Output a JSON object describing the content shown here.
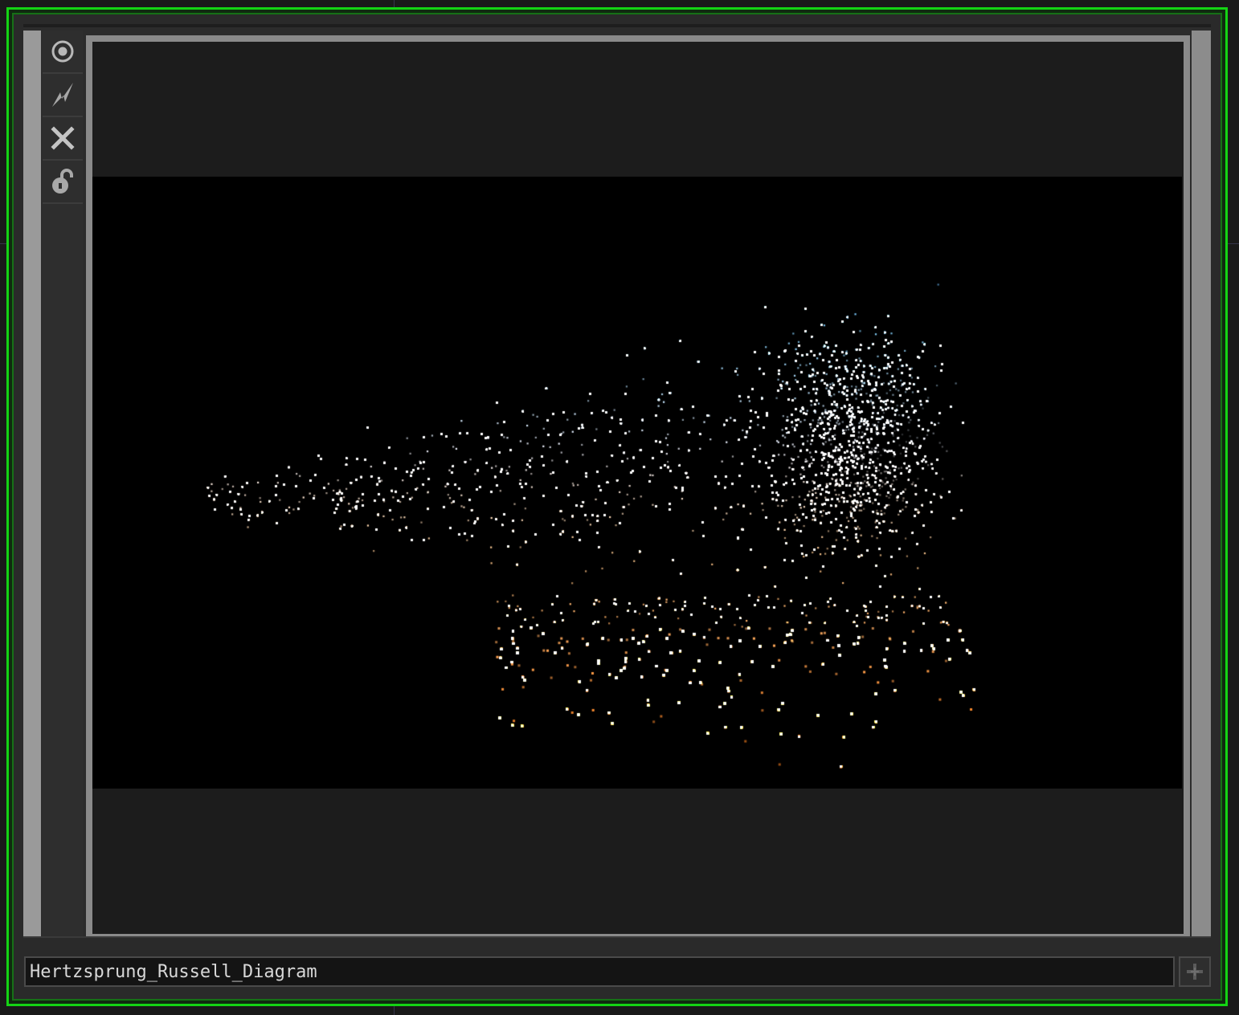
{
  "window": {
    "operator_name": "Hertzsprung_Russell_Diagram"
  },
  "toolbar": {
    "buttons": [
      {
        "name": "viewer-active-toggle",
        "icon": "target-icon"
      },
      {
        "name": "bypass-toggle",
        "icon": "lightning-icon"
      },
      {
        "name": "close-button",
        "icon": "close-icon"
      },
      {
        "name": "lock-toggle",
        "icon": "unlock-icon"
      }
    ]
  },
  "colors": {
    "node_outline_selected": "#14d414",
    "viewer_background": "#000000",
    "blue_star": "#3f7fff",
    "white_star": "#ffffff",
    "orange_star": "#ff8a1a"
  },
  "add_button": {
    "icon": "plus-icon"
  }
}
